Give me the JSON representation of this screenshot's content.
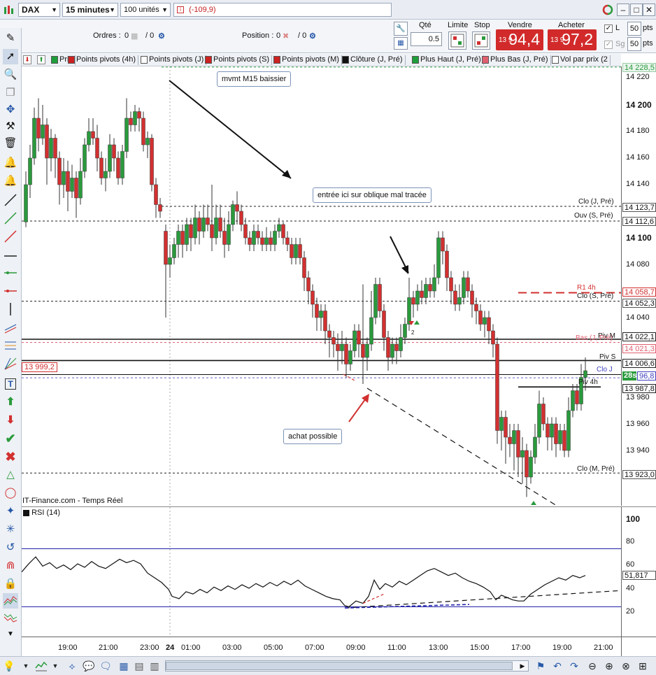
{
  "titlebar": {
    "instrument": "DAX",
    "timeframe": "15 minutes",
    "units": "100 unités",
    "pnl": "(-109,9)"
  },
  "order_panel": {
    "orders_label": "Ordres :",
    "orders_count": "0",
    "orders_pending": "/ 0",
    "position_label": "Position :",
    "position_count": "0",
    "position_pending": "/ 0",
    "qty_label": "Qté",
    "qty_value": "0.5",
    "limit_label": "Limite",
    "stop_label": "Stop",
    "sell_label": "Vendre",
    "buy_label": "Acheter",
    "sell_prefix": "13 9",
    "sell_price": "94,4",
    "buy_prefix": "13 9",
    "buy_price": "97,2",
    "l_label": "L",
    "sg_label": "Sg",
    "pts_value_1": "50",
    "pts_value_2": "50",
    "pts_label": "pts"
  },
  "legend": [
    {
      "label": "Prix",
      "color": "#1e9e3a"
    },
    {
      "label": "Points pivots (4h)",
      "color": "#cc2222"
    },
    {
      "label": "Points pivots (J)",
      "color": "#ffffff"
    },
    {
      "label": "Points pivots (S)",
      "color": "#cc2222"
    },
    {
      "label": "Points pivots (M)",
      "color": "#cc2222"
    },
    {
      "label": "Clôture (J, Pré)",
      "color": "#111111"
    },
    {
      "label": "Plus Haut (J, Pré)",
      "color": "#1e9e3a"
    },
    {
      "label": "Plus Bas (J, Pré)",
      "color": "#e06070"
    },
    {
      "label": "Vol par prix (2",
      "color": "#ffffff"
    }
  ],
  "price_axis": {
    "ticks": [
      "14 220",
      "14 200",
      "14 180",
      "14 160",
      "14 140",
      "14 100",
      "14 080",
      "14 040",
      "13 980",
      "13 960",
      "13 940"
    ],
    "tags": {
      "top": "14 228,5",
      "clo_j": "14 123,7",
      "ouv_s": "14 112,6",
      "r1": "14 058,7",
      "clo_s": "14 052,3",
      "piv_m": "14 022,1",
      "bas_j": "14 021,3",
      "piv_s": "14 006,6",
      "timer": "28s",
      "clo_j2": "96,8",
      "piv_4h": "13 987,8",
      "clo_m": "13 923,0"
    }
  },
  "chart_labels": {
    "clo_j": "Clo (J, Pré)",
    "ouv_s": "Ouv (S, Pré)",
    "r1_4h": "R1 4h",
    "clo_s": "Clo (S, Pré)",
    "piv_m": "Piv M",
    "bas_j": "Bas (J, Pré)",
    "piv_s": "Piv S",
    "clo_j2": "Clo J",
    "piv_4h": "Piv 4h",
    "clo_m": "Clo (M, Pré)",
    "left_price": "13 999,2",
    "source": "IT-Finance.com - Temps Réel",
    "signal_num": "2"
  },
  "annotations": {
    "mvmt": "mvmt M15 baissier",
    "entree": "entrée ici sur oblique mal tracée",
    "achat": "achat possible"
  },
  "rsi": {
    "title": "RSI (14)",
    "ticks": [
      "100",
      "80",
      "60",
      "40",
      "20"
    ],
    "value": "51,817"
  },
  "time_axis": [
    "19:00",
    "21:00",
    "23:00",
    "24",
    "01:00",
    "03:00",
    "05:00",
    "07:00",
    "09:00",
    "11:00",
    "13:00",
    "15:00",
    "17:00",
    "19:00",
    "21:00"
  ],
  "colors": {
    "bull": "#2a9a3c",
    "bear": "#d23030",
    "sell_bg": "#d22a2a",
    "buy_bg": "#d22a2a",
    "rsi_band": "#2222aa"
  }
}
